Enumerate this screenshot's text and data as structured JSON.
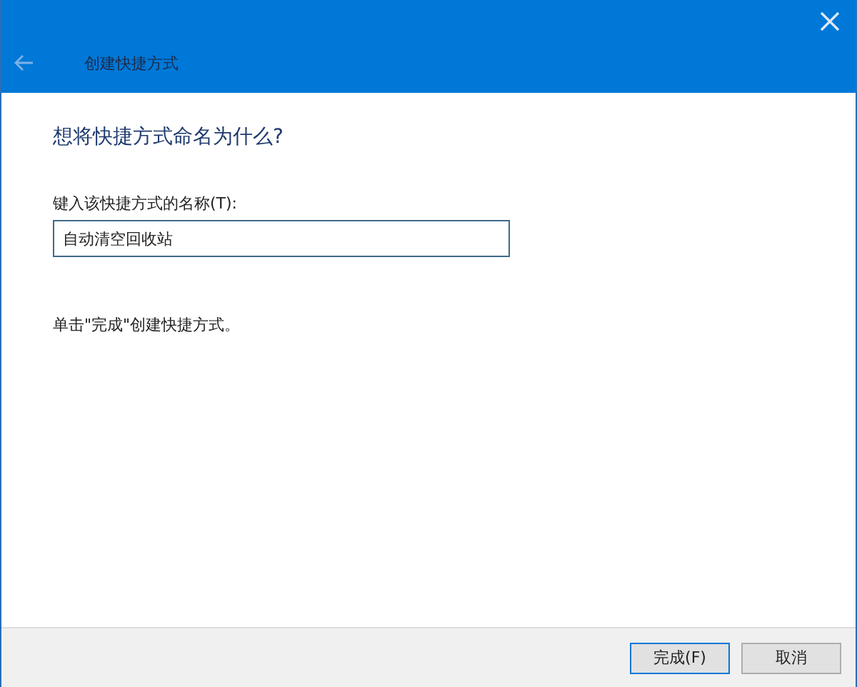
{
  "window": {
    "title": "创建快捷方式"
  },
  "heading": "想将快捷方式命名为什么?",
  "name_field": {
    "label": "键入该快捷方式的名称(T):",
    "value": "自动清空回收站"
  },
  "hint": "单击\"完成\"创建快捷方式。",
  "buttons": [
    {
      "label": "完成(F)",
      "default": true
    },
    {
      "label": "取消",
      "default": false
    }
  ]
}
